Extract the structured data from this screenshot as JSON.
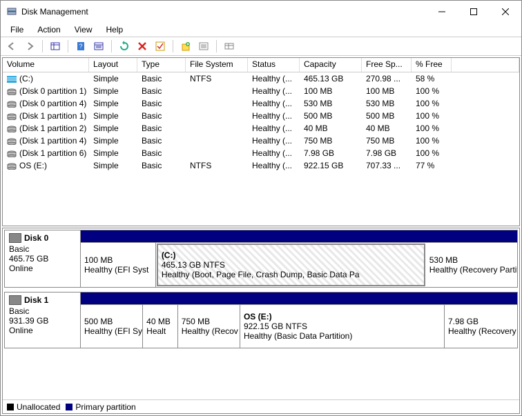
{
  "window": {
    "title": "Disk Management"
  },
  "menu": {
    "file": "File",
    "action": "Action",
    "view": "View",
    "help": "Help"
  },
  "columns": {
    "volume": "Volume",
    "layout": "Layout",
    "type": "Type",
    "fs": "File System",
    "status": "Status",
    "capacity": "Capacity",
    "free": "Free Sp...",
    "pct": "% Free"
  },
  "volumes": [
    {
      "icon": "stripe",
      "name": "(C:)",
      "layout": "Simple",
      "type": "Basic",
      "fs": "NTFS",
      "status": "Healthy (...",
      "capacity": "465.13 GB",
      "free": "270.98 ...",
      "pct": "58 %"
    },
    {
      "icon": "disk",
      "name": "(Disk 0 partition 1)",
      "layout": "Simple",
      "type": "Basic",
      "fs": "",
      "status": "Healthy (...",
      "capacity": "100 MB",
      "free": "100 MB",
      "pct": "100 %"
    },
    {
      "icon": "disk",
      "name": "(Disk 0 partition 4)",
      "layout": "Simple",
      "type": "Basic",
      "fs": "",
      "status": "Healthy (...",
      "capacity": "530 MB",
      "free": "530 MB",
      "pct": "100 %"
    },
    {
      "icon": "disk",
      "name": "(Disk 1 partition 1)",
      "layout": "Simple",
      "type": "Basic",
      "fs": "",
      "status": "Healthy (...",
      "capacity": "500 MB",
      "free": "500 MB",
      "pct": "100 %"
    },
    {
      "icon": "disk",
      "name": "(Disk 1 partition 2)",
      "layout": "Simple",
      "type": "Basic",
      "fs": "",
      "status": "Healthy (...",
      "capacity": "40 MB",
      "free": "40 MB",
      "pct": "100 %"
    },
    {
      "icon": "disk",
      "name": "(Disk 1 partition 4)",
      "layout": "Simple",
      "type": "Basic",
      "fs": "",
      "status": "Healthy (...",
      "capacity": "750 MB",
      "free": "750 MB",
      "pct": "100 %"
    },
    {
      "icon": "disk",
      "name": "(Disk 1 partition 6)",
      "layout": "Simple",
      "type": "Basic",
      "fs": "",
      "status": "Healthy (...",
      "capacity": "7.98 GB",
      "free": "7.98 GB",
      "pct": "100 %"
    },
    {
      "icon": "disk",
      "name": "OS (E:)",
      "layout": "Simple",
      "type": "Basic",
      "fs": "NTFS",
      "status": "Healthy (...",
      "capacity": "922.15 GB",
      "free": "707.33 ...",
      "pct": "77 %"
    }
  ],
  "disks": [
    {
      "name": "Disk 0",
      "type": "Basic",
      "size": "465.75 GB",
      "status": "Online",
      "parts": [
        {
          "label": "",
          "size": "100 MB",
          "status": "Healthy (EFI Syst",
          "flex": 1.2,
          "selected": false
        },
        {
          "label": "(C:)",
          "size": "465.13 GB NTFS",
          "status": "Healthy (Boot, Page File, Crash Dump, Basic Data Pa",
          "flex": 4.6,
          "selected": true
        },
        {
          "label": "",
          "size": "530 MB",
          "status": "Healthy (Recovery Partit",
          "flex": 1.5,
          "selected": false
        }
      ]
    },
    {
      "name": "Disk 1",
      "type": "Basic",
      "size": "931.39 GB",
      "status": "Online",
      "parts": [
        {
          "label": "",
          "size": "500 MB",
          "status": "Healthy (EFI Sy",
          "flex": 1.0,
          "selected": false
        },
        {
          "label": "",
          "size": "40 MB",
          "status": "Healt",
          "flex": 0.5,
          "selected": false
        },
        {
          "label": "",
          "size": "750 MB",
          "status": "Healthy (Recov",
          "flex": 1.0,
          "selected": false
        },
        {
          "label": "OS  (E:)",
          "size": "922.15 GB NTFS",
          "status": "Healthy (Basic Data Partition)",
          "flex": 3.6,
          "selected": false
        },
        {
          "label": "",
          "size": "7.98 GB",
          "status": "Healthy (Recovery Par",
          "flex": 1.2,
          "selected": false
        }
      ]
    }
  ],
  "legend": {
    "unallocated": "Unallocated",
    "primary": "Primary partition"
  }
}
